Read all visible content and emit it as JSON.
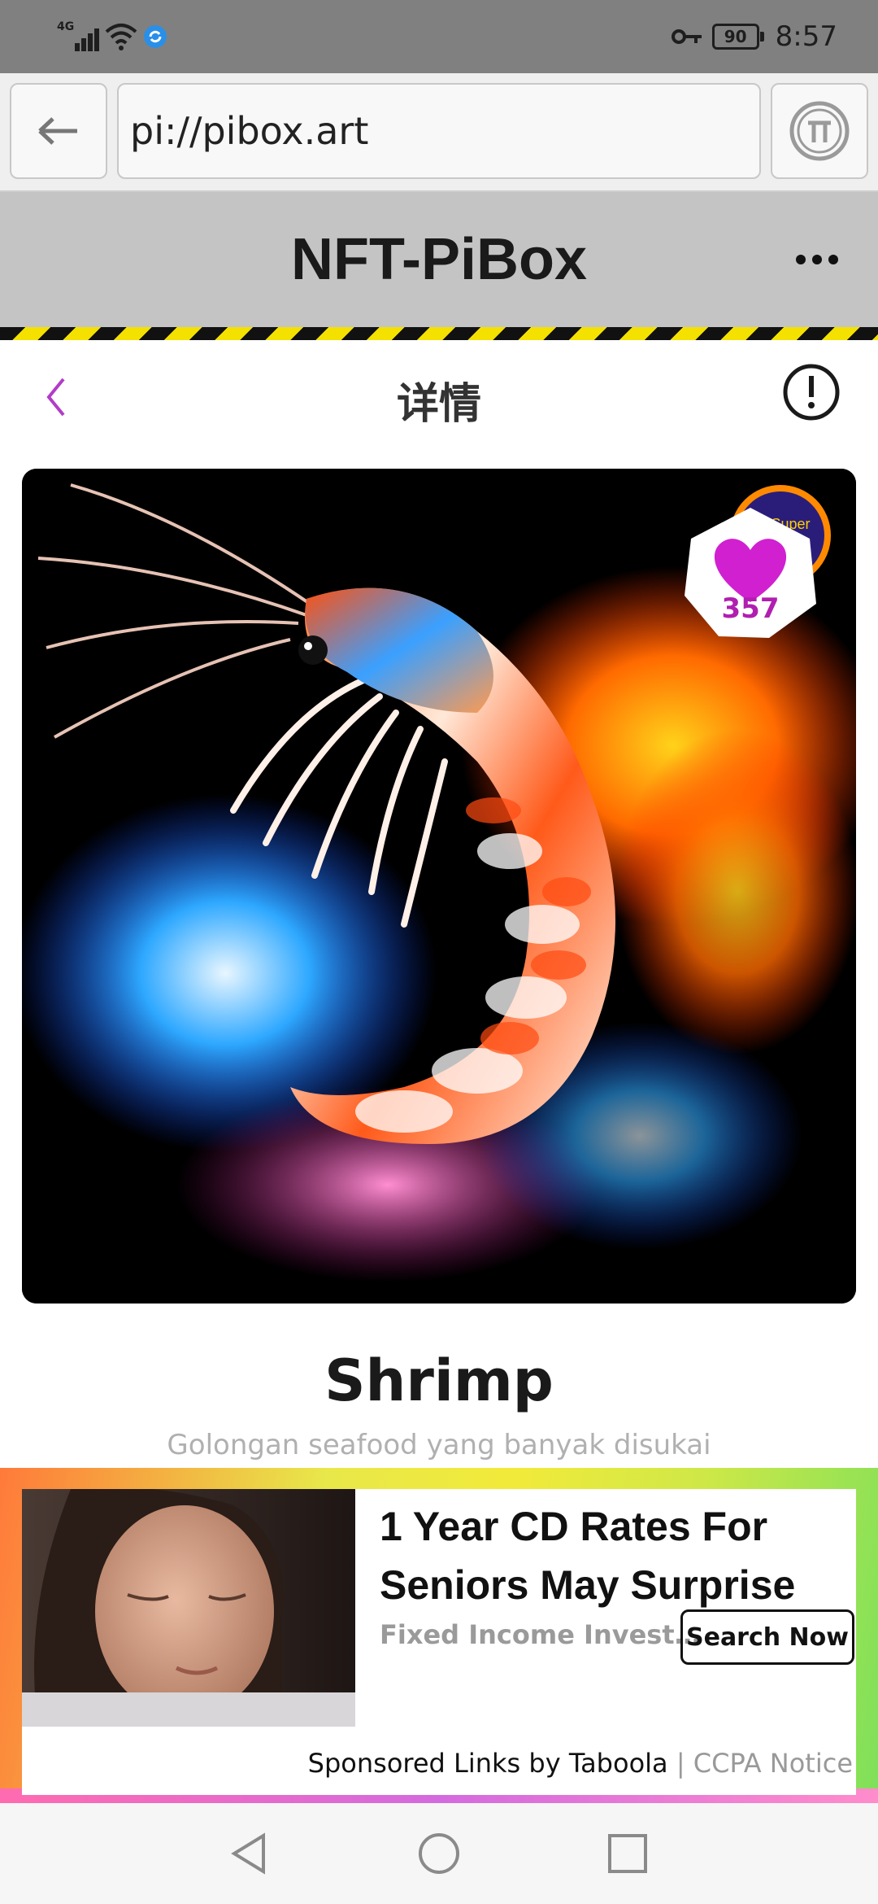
{
  "status_bar": {
    "network_label": "4G",
    "battery_level": "90",
    "time": "8:57",
    "icons": [
      "signal-icon",
      "wifi-icon",
      "sync-app-icon",
      "key-icon",
      "battery-icon"
    ]
  },
  "browser": {
    "url": "pi://pibox.art",
    "icons": [
      "back-arrow-icon",
      "pi-network-icon"
    ]
  },
  "app_header": {
    "title": "NFT-PiBox",
    "icons": [
      "more-dots-icon"
    ]
  },
  "detail": {
    "title": "详情",
    "icons": [
      "chevron-left-icon",
      "info-exclamation-icon"
    ]
  },
  "nft": {
    "like_count": "357",
    "name": "Shrimp",
    "description": "Golongan seafood yang banyak disukai",
    "badge_text": "Pi Super",
    "icons": [
      "heart-icon"
    ],
    "like_color": "#d020d0"
  },
  "ad": {
    "headline": "1 Year CD Rates For Seniors May Surprise",
    "brand": "Fixed Income Invest…",
    "cta": "Search Now",
    "footer_sponsored": "Sponsored Links by Taboola",
    "footer_separator": "|",
    "footer_ccpa": "CCPA Notice"
  },
  "nav": {
    "icons": [
      "nav-back-icon",
      "nav-home-icon",
      "nav-recents-icon"
    ]
  }
}
